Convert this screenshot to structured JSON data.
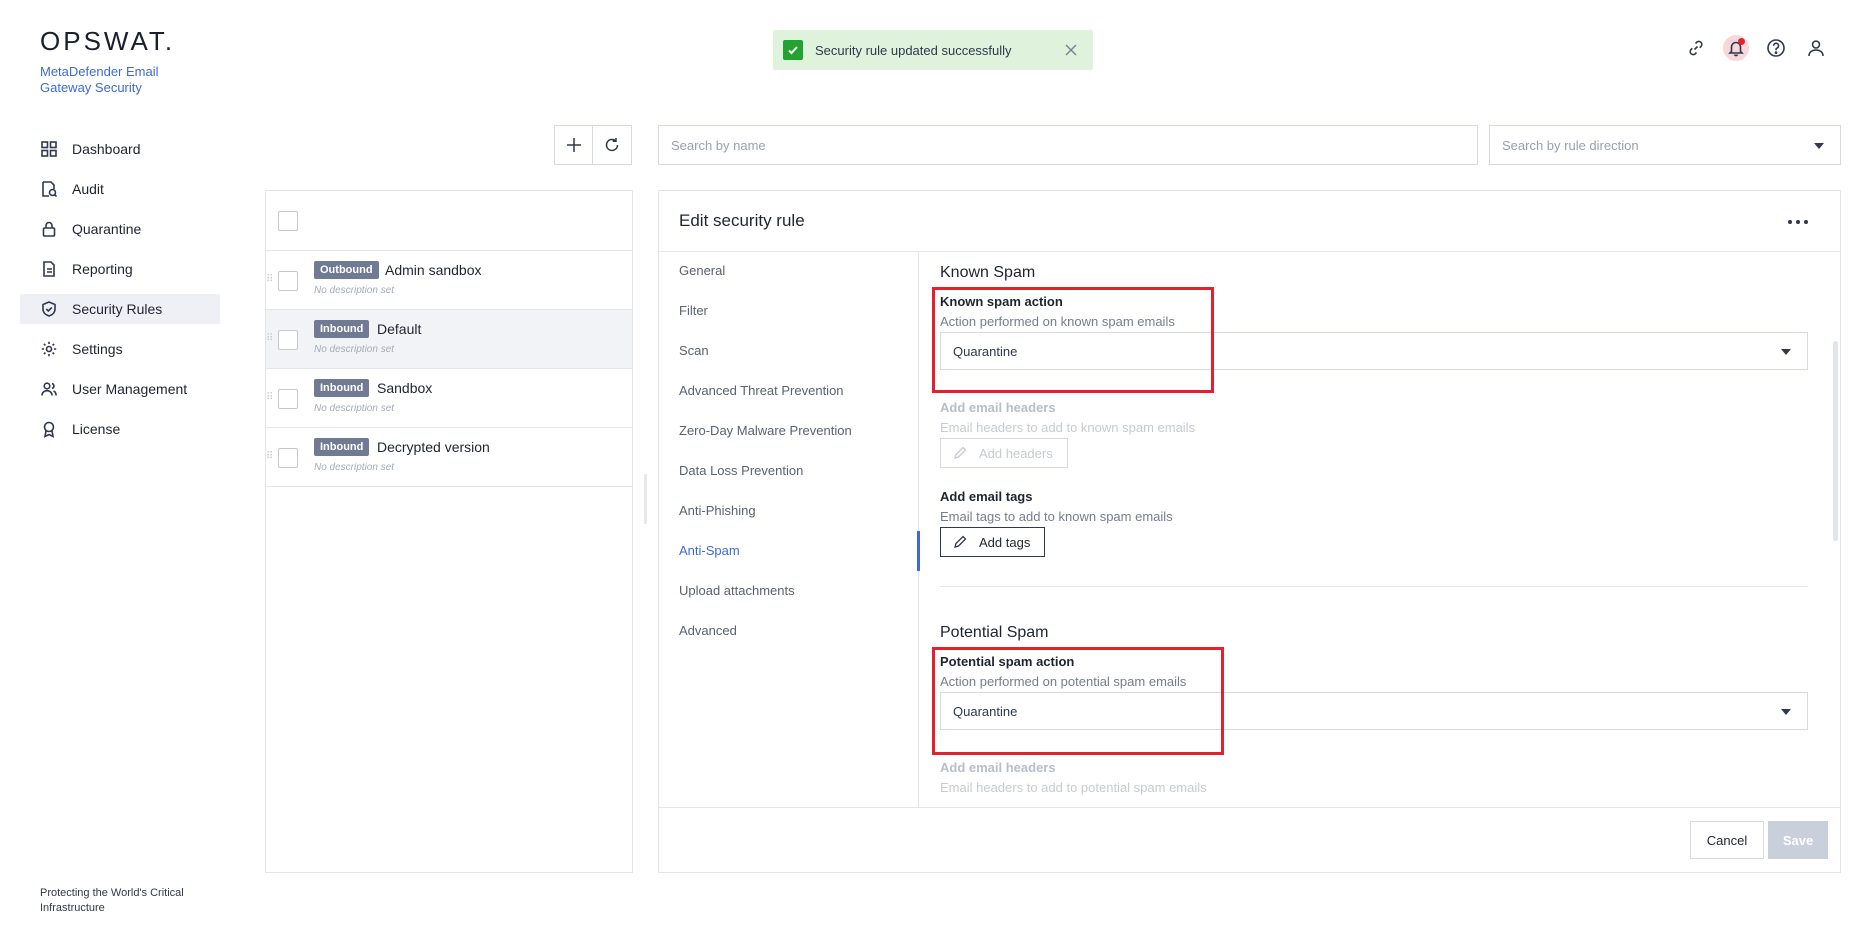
{
  "brand": {
    "logo_text": "OPSWAT.",
    "product_name": "MetaDefender Email Gateway Security",
    "footer": "Protecting the World's Critical Infrastructure"
  },
  "sidebar": {
    "items": [
      {
        "label": "Dashboard",
        "icon": "dashboard-icon"
      },
      {
        "label": "Audit",
        "icon": "audit-icon"
      },
      {
        "label": "Quarantine",
        "icon": "lock-icon"
      },
      {
        "label": "Reporting",
        "icon": "report-icon"
      },
      {
        "label": "Security Rules",
        "icon": "shield-icon",
        "active": true
      },
      {
        "label": "Settings",
        "icon": "gear-icon"
      },
      {
        "label": "User Management",
        "icon": "users-icon"
      },
      {
        "label": "License",
        "icon": "license-icon"
      }
    ]
  },
  "toast": {
    "message": "Security rule updated successfully",
    "color": "#22a230"
  },
  "toolbar": {
    "search_placeholder": "Search by name",
    "direction_placeholder": "Search by rule direction"
  },
  "rules": [
    {
      "direction": "Outbound",
      "name": "Admin sandbox",
      "description": "No description set"
    },
    {
      "direction": "Inbound",
      "name": "Default",
      "description": "No description set",
      "selected": true
    },
    {
      "direction": "Inbound",
      "name": "Sandbox",
      "description": "No description set"
    },
    {
      "direction": "Inbound",
      "name": "Decrypted version",
      "description": "No description set"
    }
  ],
  "editor": {
    "title": "Edit security rule",
    "tabs": [
      "General",
      "Filter",
      "Scan",
      "Advanced Threat Prevention",
      "Zero-Day Malware Prevention",
      "Data Loss Prevention",
      "Anti-Phishing",
      "Anti-Spam",
      "Upload attachments",
      "Advanced"
    ],
    "active_tab": "Anti-Spam",
    "known_spam": {
      "section_title": "Known Spam",
      "action_label": "Known spam action",
      "action_sub": "Action performed on known spam emails",
      "action_value": "Quarantine",
      "headers_label": "Add email headers",
      "headers_sub": "Email headers to add to known spam emails",
      "headers_button": "Add headers",
      "tags_label": "Add email tags",
      "tags_sub": "Email tags to add to known spam emails",
      "tags_button": "Add tags"
    },
    "potential_spam": {
      "section_title": "Potential Spam",
      "action_label": "Potential spam action",
      "action_sub": "Action performed on potential spam emails",
      "action_value": "Quarantine",
      "headers_label": "Add email headers",
      "headers_sub": "Email headers to add to potential spam emails"
    },
    "cancel_label": "Cancel",
    "save_label": "Save"
  },
  "colors": {
    "accent": "#3d6ad6",
    "highlight": "#e3202e",
    "badge": "#707a93"
  }
}
